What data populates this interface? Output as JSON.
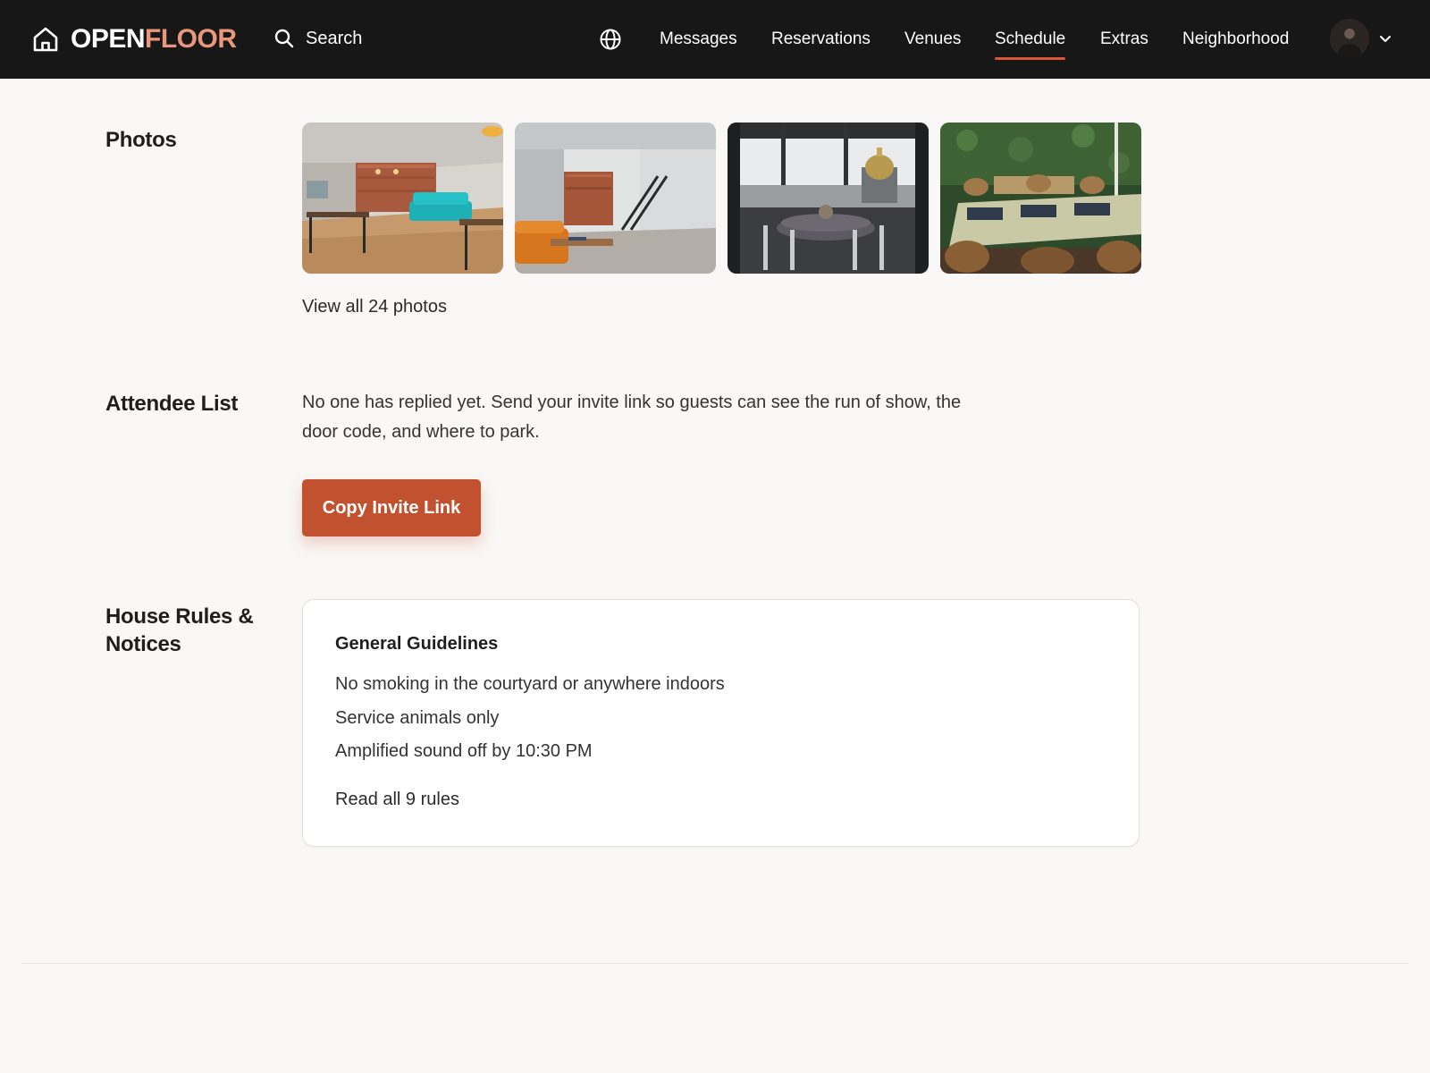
{
  "brand": {
    "part1": "OPEN",
    "part2": "FLOOR"
  },
  "search": {
    "label": "Search"
  },
  "nav": {
    "items": [
      {
        "label": "Messages",
        "active": false
      },
      {
        "label": "Reservations",
        "active": false
      },
      {
        "label": "Venues",
        "active": false
      },
      {
        "label": "Schedule",
        "active": true
      },
      {
        "label": "Extras",
        "active": false
      },
      {
        "label": "Neighborhood",
        "active": false
      }
    ]
  },
  "colors": {
    "topbar": "#171717",
    "accent": "#c2512f",
    "active_underline": "#d9563a",
    "brand_secondary": "#e9977a",
    "background": "#f9f8f6"
  },
  "icons": {
    "logo": "house-icon",
    "search": "search-icon",
    "language": "globe-icon",
    "account_menu": "chevron-down-icon"
  },
  "photos": {
    "title": "Photos",
    "view_all": "View all 24 photos"
  },
  "attendees": {
    "title": "Attendee List",
    "empty_message": "No one has replied yet. Send your invite link so guests can see the run of show, the door code, and where to park.",
    "copy_button": "Copy Invite Link"
  },
  "house_rules": {
    "title_line1": "House Rules &",
    "title_line2": "Notices",
    "card_title": "General Guidelines",
    "rules": [
      "No smoking in the courtyard or anywhere indoors",
      "Service animals only",
      "Amplified sound off by 10:30 PM"
    ],
    "read_all": "Read all 9 rules"
  }
}
